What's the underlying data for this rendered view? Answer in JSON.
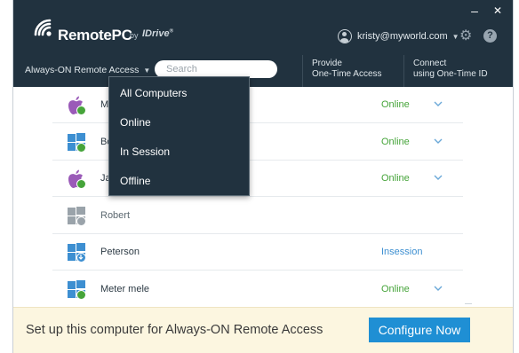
{
  "app": {
    "name": "RemotePC",
    "by": "by",
    "brand": "IDrive",
    "brand_mark": "®"
  },
  "window_controls": {
    "minimize": "–",
    "close": "✕"
  },
  "user": {
    "email": "kristy@myworld.com",
    "icon": "user-icon",
    "caret": "▼"
  },
  "toolbar": {
    "settings_icon": "gear-icon",
    "help_label": "?"
  },
  "nav": {
    "filter_label": "Always-ON Remote Access",
    "filter_caret": "▼",
    "search_placeholder": "Search",
    "link1_line1": "Provide",
    "link1_line2": "One-Time Access",
    "link2_line1": "Connect",
    "link2_line2": "using One-Time ID"
  },
  "filter_menu": {
    "items": [
      "All Computers",
      "Online",
      "In Session",
      "Offline"
    ]
  },
  "computers": [
    {
      "name": "M",
      "os": "mac",
      "status": "Online",
      "state": "online",
      "expandable": true
    },
    {
      "name": "Bo",
      "os": "windows",
      "status": "Online",
      "state": "online",
      "expandable": true
    },
    {
      "name": "Ja",
      "os": "mac",
      "status": "Online",
      "state": "online",
      "expandable": true
    },
    {
      "name": "Robert",
      "os": "windows",
      "status": "",
      "state": "offline",
      "expandable": false
    },
    {
      "name": "Peterson",
      "os": "windows",
      "status": "Insession",
      "state": "insession",
      "expandable": false
    },
    {
      "name": "Meter mele",
      "os": "windows",
      "status": "Online",
      "state": "online",
      "expandable": true
    }
  ],
  "colors": {
    "header_bg": "#21323f",
    "online": "#46a43a",
    "insession": "#3d8fd1",
    "accent_button": "#1f8fd4",
    "footer_bg": "#fcf6e0"
  },
  "footer": {
    "message": "Set up this computer for Always-ON Remote Access",
    "button_label": "Configure Now"
  }
}
